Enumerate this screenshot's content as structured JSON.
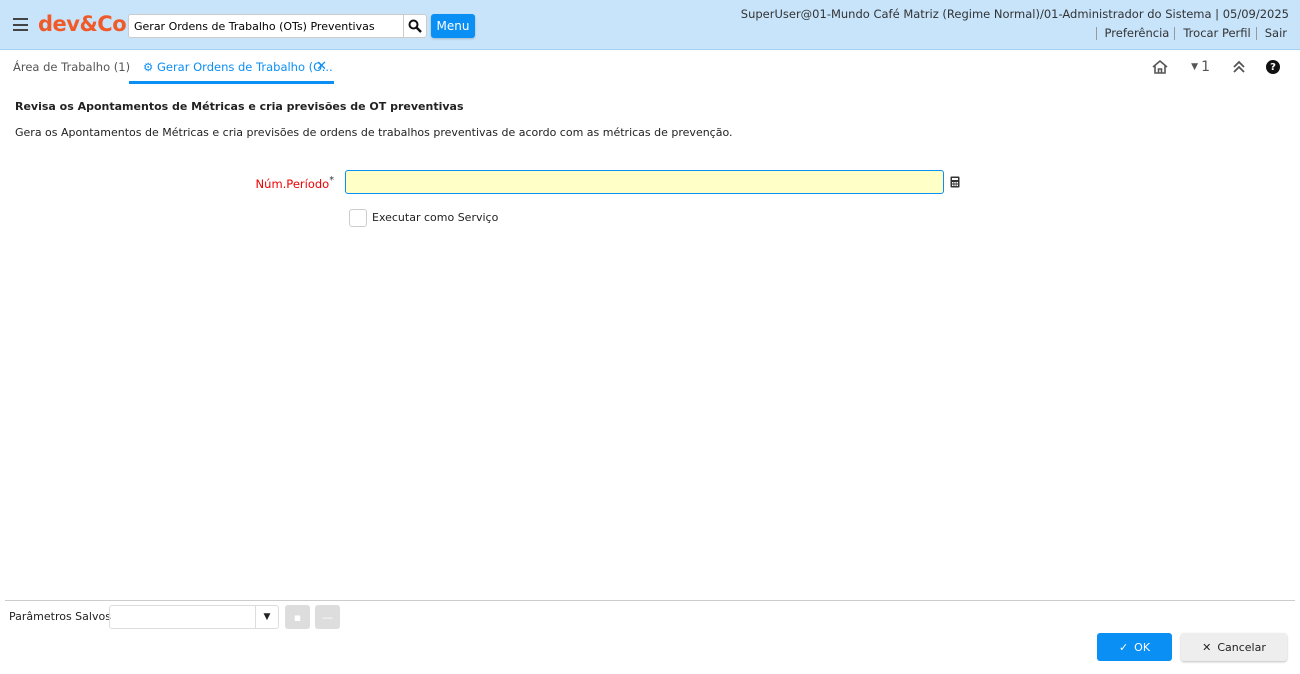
{
  "header": {
    "logo": "dev&Co.",
    "search_value": "Gerar Ordens de Trabalho (OTs) Preventivas",
    "menu_label": "Menu",
    "user_info": "SuperUser@01-Mundo Café Matriz (Regime Normal)/01-Administrador do Sistema | 05/09/2025",
    "links": [
      "Preferência",
      "Trocar Perfil",
      "Sair"
    ]
  },
  "tabs": [
    {
      "label": "Área de Trabalho (1)"
    },
    {
      "label": "Gerar Ordens de Trabalho (O..."
    }
  ],
  "tab_tools": {
    "count": "1"
  },
  "main": {
    "title": "Revisa os Apontamentos de Métricas e cria previsões de OT preventivas",
    "description": "Gera os Apontamentos de Métricas e cria previsões de ordens de trabalhos preventivas de acordo com as métricas de prevenção.",
    "period_label": "Núm.Período",
    "required_mark": "*",
    "period_value": "",
    "service_label": "Executar como Serviço"
  },
  "footer": {
    "saved_params_label": "Parâmetros Salvos",
    "saved_params_value": "",
    "ok_label": "OK",
    "cancel_label": "Cancelar"
  }
}
